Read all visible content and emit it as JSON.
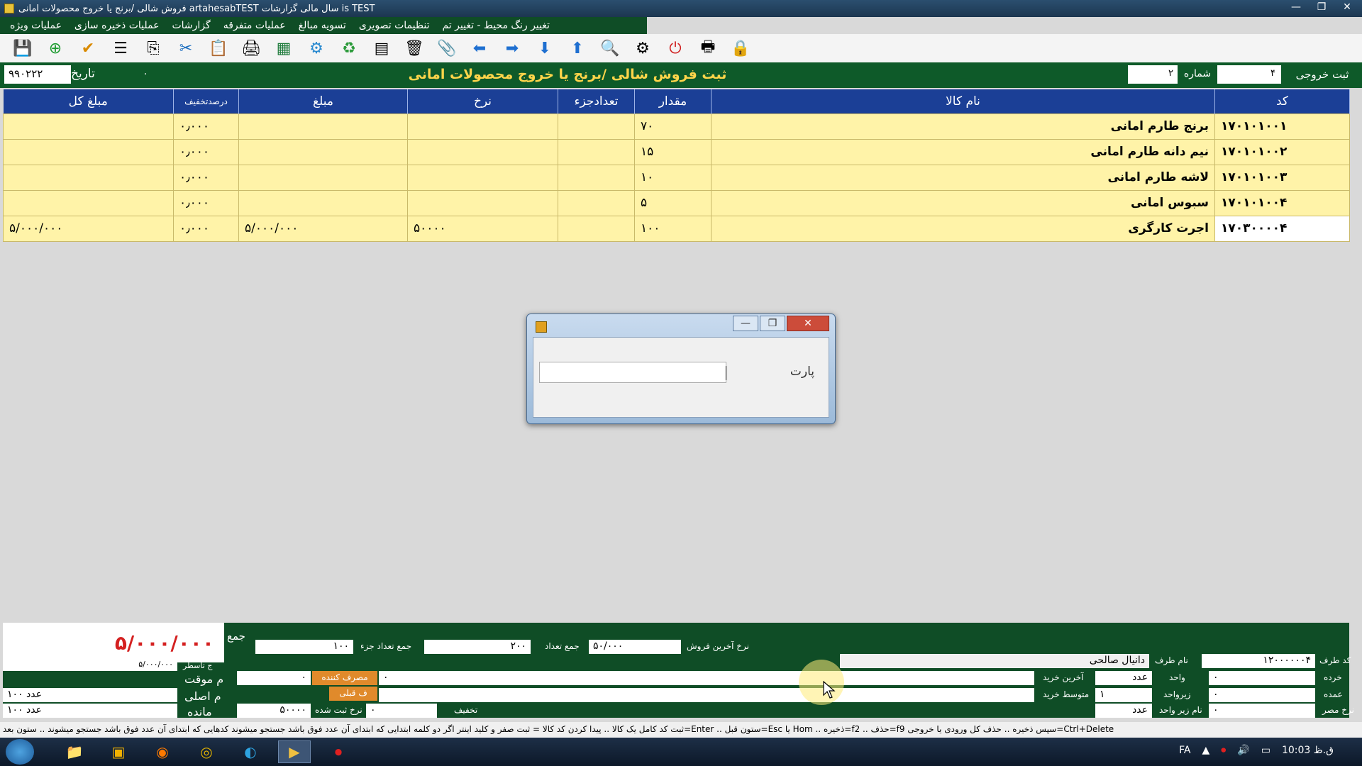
{
  "window": {
    "title": "فروش شالی /برنج یا خروج محصولات امانی     artahesabTEST     سال مالی گزارشات is TEST",
    "controls": [
      "—",
      "❐",
      "✕"
    ]
  },
  "menu": {
    "items": [
      "عملیات ویژه",
      "عملیات ذخیره سازی",
      "گزارشات",
      "عملیات متفرقه",
      "تسویه مبالغ",
      "تنظیمات تصویری",
      "تغییر رنگ محیط - تغییر تم"
    ]
  },
  "toolbar": {
    "icons": [
      "save-icon",
      "add-icon",
      "check-icon",
      "list-icon",
      "copy-icon",
      "cut-icon",
      "paste-icon",
      "print-icon",
      "excel-icon",
      "settings-icon",
      "recycle-icon",
      "calculator-icon",
      "delete-icon",
      "clipboard-icon",
      "arrow-left-icon",
      "arrow-right-icon",
      "arrow-down-icon",
      "arrow-up-icon",
      "search-icon",
      "gear-icon",
      "power-icon",
      "printer-icon",
      "lock-icon"
    ]
  },
  "header": {
    "title": "ثبت فروش شالی /برنج یا خروج محصولات امانی",
    "date_label": "تاریخ",
    "date_value": "۹۹۰۲۲۲",
    "num_value": "۰",
    "shomare_label": "شماره",
    "shomare_value": "۲",
    "type_label": "ثبت خروجی",
    "type_value": "۴"
  },
  "grid": {
    "columns": [
      "کد",
      "نام کالا",
      "مقدار",
      "تعدادجزء",
      "نرخ",
      "مبلغ",
      "درصدتخفیف",
      "مبلغ کل"
    ],
    "rows": [
      {
        "code": "۱۷۰۱۰۱۰۰۱",
        "name": "برنج طارم امانی",
        "qty": "۷۰",
        "parts": "",
        "rate": "",
        "amount": "",
        "discount": "۰٫۰۰۰",
        "total": ""
      },
      {
        "code": "۱۷۰۱۰۱۰۰۲",
        "name": "نیم دانه طارم امانی",
        "qty": "۱۵",
        "parts": "",
        "rate": "",
        "amount": "",
        "discount": "۰٫۰۰۰",
        "total": ""
      },
      {
        "code": "۱۷۰۱۰۱۰۰۳",
        "name": "لاشه طارم امانی",
        "qty": "۱۰",
        "parts": "",
        "rate": "",
        "amount": "",
        "discount": "۰٫۰۰۰",
        "total": ""
      },
      {
        "code": "۱۷۰۱۰۱۰۰۴",
        "name": "سبوس امانی",
        "qty": "۵",
        "parts": "",
        "rate": "",
        "amount": "",
        "discount": "۰٫۰۰۰",
        "total": ""
      },
      {
        "code": "۱۷۰۳۰۰۰۰۴",
        "name": "اجرت کارگری",
        "qty": "۱۰۰",
        "parts": "",
        "rate": "۵۰۰۰۰",
        "amount": "۵/۰۰۰/۰۰۰",
        "discount": "۰٫۰۰۰",
        "total": "۵/۰۰۰/۰۰۰"
      }
    ]
  },
  "dialog": {
    "label": "پارت",
    "input_value": ""
  },
  "bottom": {
    "total_label": "جمع",
    "total_value": "۵/۰۰۰/۰۰۰",
    "sum_parts_label": "جمع تعداد جزء",
    "sum_parts_value": "۱۰۰",
    "sum_count_label": "جمع تعداد",
    "sum_count_value": "۲۰۰",
    "last_sale_rate_label": "نرخ آخرین فروش",
    "last_sale_rate_value": "۵۰/۰۰۰",
    "party_code_label": "کد طرف",
    "party_code_value": "۱۲۰۰۰۰۰۰۴",
    "party_name_label": "نام طرف",
    "party_name_value": "دانیال صالحی",
    "row_total_label": "ج تاسطر",
    "row_total_value": "۵/۰۰۰/۰۰۰",
    "temp_label": "م موقت",
    "temp_value": "۰",
    "consumer_label": "مصرف کننده",
    "last_buy_label": "آخرین خرید",
    "last_buy_value": "۰",
    "unit_label": "واحد",
    "unit_value": "عدد",
    "retail_label": "خرده",
    "retail_value": "۰",
    "main_label": "م اصلی",
    "main_value": "۱۰۰ عدد",
    "prev_label": "ف قبلی",
    "avg_buy_label": "متوسط خرید",
    "subunit_label": "زیرواحد",
    "subunit_value": "۱",
    "wholesale_label": "عمده",
    "wholesale_value": "۰",
    "remain_label": "مانده",
    "remain_value": "۱۰۰ عدد",
    "reg_rate_label": "نرخ ثبت شده",
    "reg_rate_value": "۵۰۰۰۰",
    "discount_label": "تخفیف",
    "discount_value": "۰",
    "subunit_name_label": "نام زیر واحد",
    "subunit_name_value": "عدد",
    "consumer_rate_label": "نرخ مصر",
    "consumer_rate_value": "۰"
  },
  "hint": "ثبت کد کامل یک کالا .. پیدا کردن کد کالا = ثبت صفر و کلید اینتر اگر دو کلمه ابتدایی که ابتدای آن عدد فوق باشد جستجو میشوند کدهایی که ابتدای آن عدد فوق باشد جستجو میشوند .. ستون بعد=Enter .. ستون قبل=Esc یا Hom .. ذخیره=f2 .. حذف=f9 سپس ذخیره .. حذف کل ورودی یا خروجی=Ctrl+Delete",
  "taskbar": {
    "lang": "FA",
    "clock": "10:03 ق.ظ"
  },
  "colors": {
    "header_green": "#0e5a29",
    "grid_header_blue": "#1b3f96",
    "row_yellow": "#fff3a8",
    "total_red": "#d42020"
  }
}
